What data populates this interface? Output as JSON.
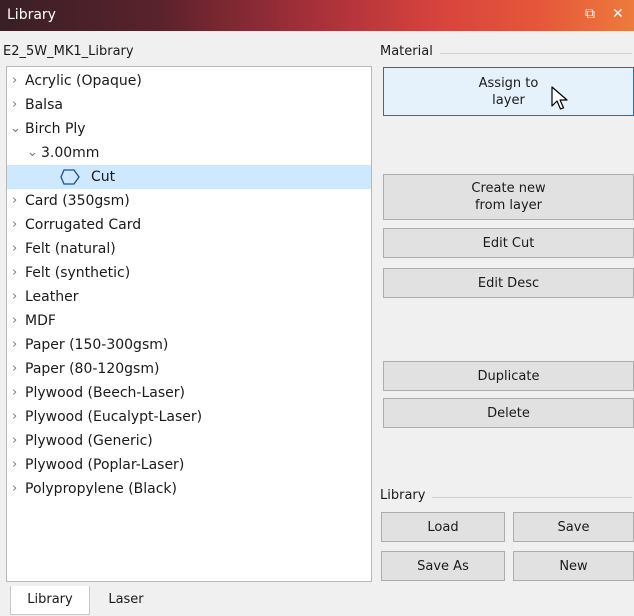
{
  "window": {
    "title": "Library",
    "restore_icon": "restore-icon",
    "close_icon": "close-icon"
  },
  "library_name": "E2_5W_MK1_Library",
  "tree": {
    "items": [
      {
        "label": "Acrylic (Opaque)",
        "level": 0,
        "expanded": false
      },
      {
        "label": "Balsa",
        "level": 0,
        "expanded": false
      },
      {
        "label": "Birch Ply",
        "level": 0,
        "expanded": true
      },
      {
        "label": "3.00mm",
        "level": 1,
        "expanded": true
      },
      {
        "label": "Cut",
        "level": 2,
        "selected": true,
        "icon": "cut-shape-icon"
      },
      {
        "label": "Card (350gsm)",
        "level": 0,
        "expanded": false
      },
      {
        "label": "Corrugated Card",
        "level": 0,
        "expanded": false
      },
      {
        "label": "Felt (natural)",
        "level": 0,
        "expanded": false
      },
      {
        "label": "Felt (synthetic)",
        "level": 0,
        "expanded": false
      },
      {
        "label": "Leather",
        "level": 0,
        "expanded": false
      },
      {
        "label": "MDF",
        "level": 0,
        "expanded": false
      },
      {
        "label": "Paper (150-300gsm)",
        "level": 0,
        "expanded": false
      },
      {
        "label": "Paper (80-120gsm)",
        "level": 0,
        "expanded": false
      },
      {
        "label": "Plywood (Beech-Laser)",
        "level": 0,
        "expanded": false
      },
      {
        "label": "Plywood (Eucalypt-Laser)",
        "level": 0,
        "expanded": false
      },
      {
        "label": "Plywood (Generic)",
        "level": 0,
        "expanded": false
      },
      {
        "label": "Plywood (Poplar-Laser)",
        "level": 0,
        "expanded": false
      },
      {
        "label": "Polypropylene (Black)",
        "level": 0,
        "expanded": false
      }
    ]
  },
  "material": {
    "section_label": "Material",
    "assign_label": "Assign to\nlayer",
    "create_label": "Create new\nfrom layer",
    "edit_cut_label": "Edit Cut",
    "edit_desc_label": "Edit Desc",
    "duplicate_label": "Duplicate",
    "delete_label": "Delete"
  },
  "library": {
    "section_label": "Library",
    "load_label": "Load",
    "save_label": "Save",
    "save_as_label": "Save As",
    "new_label": "New"
  },
  "tabs": [
    {
      "label": "Library",
      "active": true
    },
    {
      "label": "Laser",
      "active": false
    }
  ],
  "colors": {
    "selection": "#cde8ff",
    "primary_border": "#0078d7"
  }
}
